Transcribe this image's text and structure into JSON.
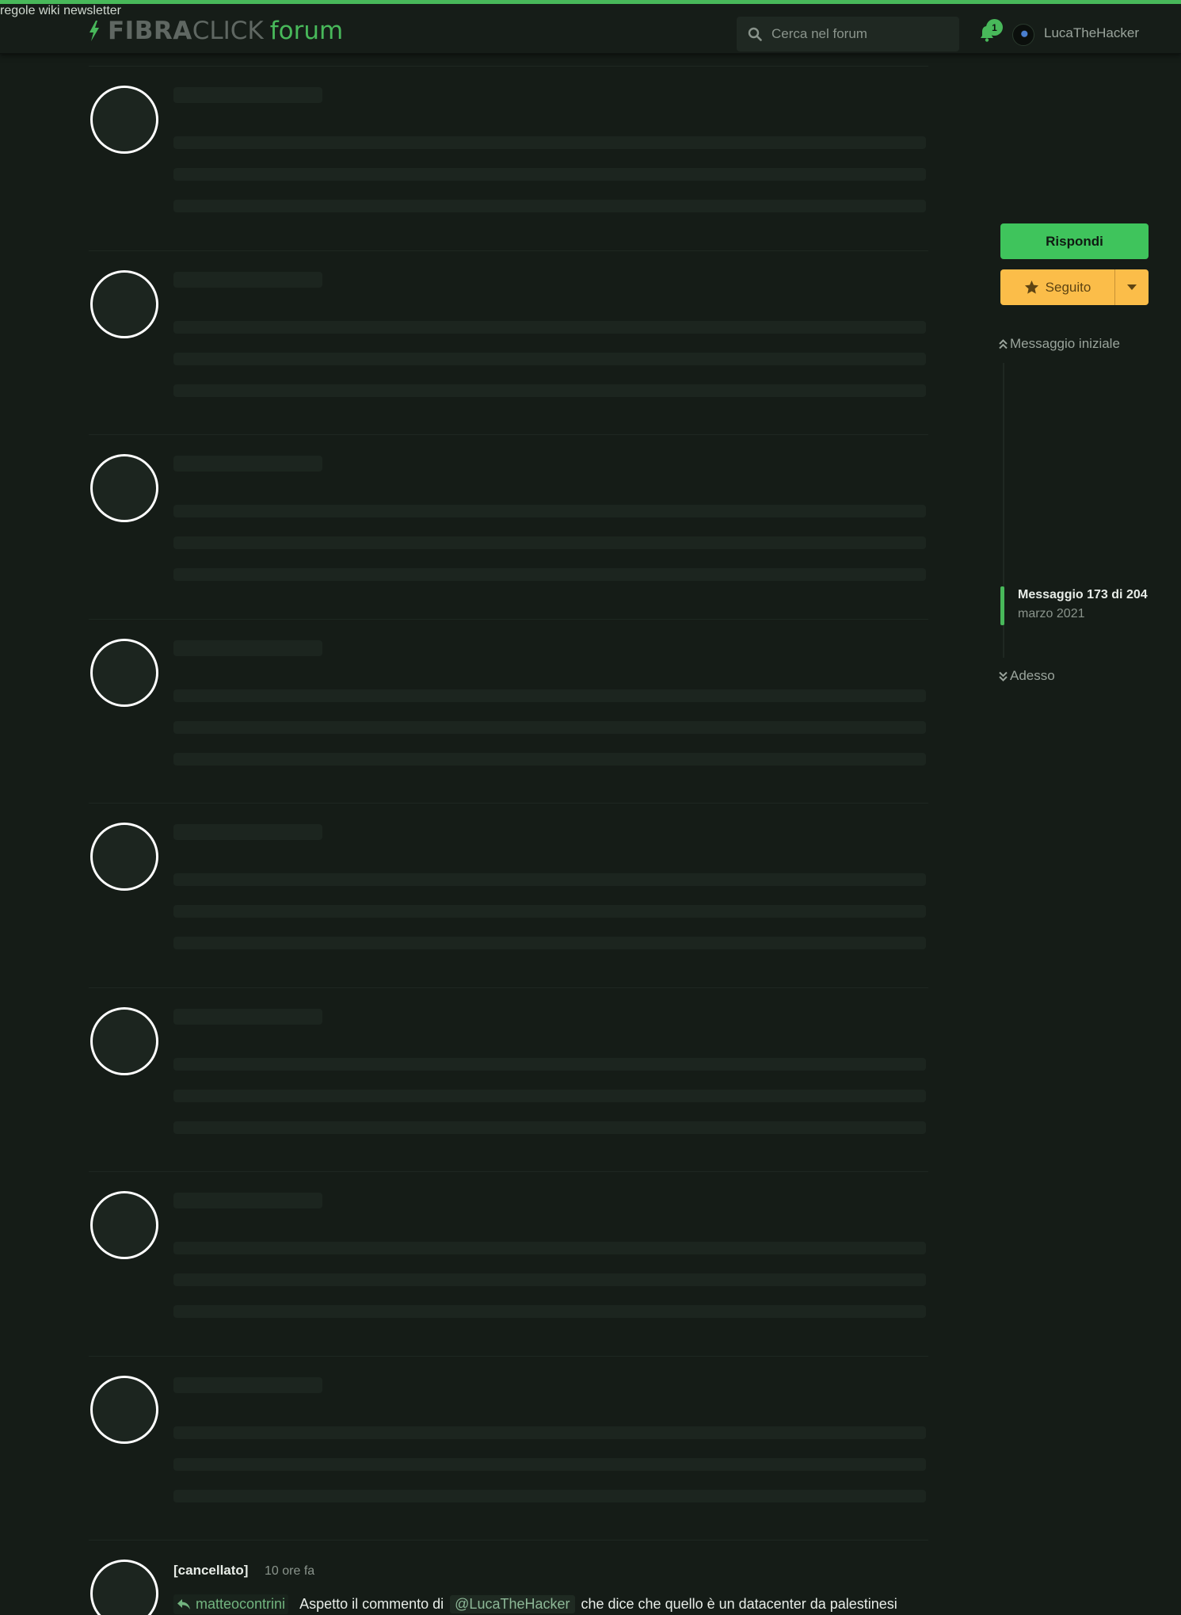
{
  "header": {
    "logo": {
      "part1": "FIBRA",
      "part2": "CLICK",
      "part3": "forum"
    },
    "nav": [
      {
        "label": "regole"
      },
      {
        "label": "wiki"
      },
      {
        "label": "newsletter"
      }
    ],
    "search": {
      "placeholder": "Cerca nel forum"
    },
    "notifications": {
      "count": "1"
    },
    "user": {
      "name": "LucaTheHacker"
    }
  },
  "sidebar": {
    "reply_label": "Rispondi",
    "follow_label": "Seguito",
    "scrubber": {
      "first_label": "Messaggio iniziale",
      "position": "Messaggio 173 di 204",
      "date": "marzo 2021",
      "last_label": "Adesso"
    }
  },
  "last_post": {
    "author": "[cancellato]",
    "time": "10 ore fa",
    "reply_to": "matteocontrini",
    "text_before": "Aspetto il commento di",
    "mention": "@LucaTheHacker",
    "text_after": "che dice che quello è un datacenter da palestinesi"
  },
  "colors": {
    "background": "#151c17",
    "accent": "#48b85a",
    "reply_button": "#3fc45c",
    "follow_button": "#fbbd49"
  },
  "icons": [
    "bolt-icon",
    "search-icon",
    "bell-icon",
    "star-icon",
    "caret-down-icon",
    "double-chevron-up-icon",
    "double-chevron-down-icon",
    "reply-icon"
  ]
}
